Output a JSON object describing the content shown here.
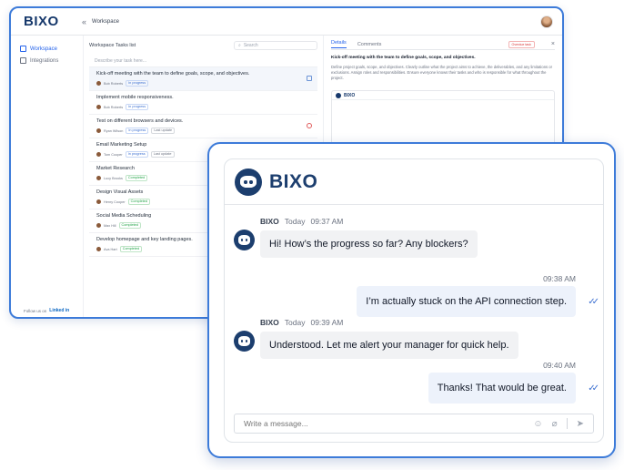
{
  "workspace": {
    "logo": "BIXO",
    "collapse_icon": "«",
    "title": "Workspace",
    "sidebar": {
      "items": [
        {
          "label": "Workspace",
          "active": true
        },
        {
          "label": "Integrations",
          "active": false
        }
      ],
      "follow_us": "Follow us on",
      "linkedin": "Linked in"
    },
    "tasks_header": {
      "name": "Workspace Tasks list",
      "search_placeholder": "Search"
    },
    "describe_placeholder": "Describe your task here...",
    "tasks": [
      {
        "title": "Kick-off meeting with the team to define goals, scope, and objectives.",
        "assignee": "Bob Roberts",
        "tags": [
          "In progress"
        ],
        "icon": "doc"
      },
      {
        "title": "Implement mobile responsiveness.",
        "assignee": "Bob Roberts",
        "tags": [
          "In progress"
        ],
        "icon": ""
      },
      {
        "title": "Test on different browsers and devices.",
        "assignee": "Ryan Wilson",
        "tags": [
          "In progress",
          "Last update"
        ],
        "icon": "alert"
      },
      {
        "title": "Email Marketing Setup",
        "assignee": "Tom Cooper",
        "tags": [
          "In progress",
          "Last update"
        ],
        "icon": ""
      },
      {
        "title": "Market Research",
        "assignee": "Lucy Brooks",
        "tags": [
          "Completed"
        ],
        "icon": ""
      },
      {
        "title": "Design Visual Assets",
        "assignee": "Henry Cooper",
        "tags": [
          "Completed"
        ],
        "icon": ""
      },
      {
        "title": "Social Media Scheduling",
        "assignee": "Max Hill",
        "tags": [
          "Completed"
        ],
        "icon": ""
      },
      {
        "title": "Develop homepage and key landing pages.",
        "assignee": "Ava Hart",
        "tags": [
          "Completed"
        ],
        "icon": ""
      }
    ],
    "details": {
      "tabs": [
        "Details",
        "Comments"
      ],
      "badge": "Overdue task",
      "title": "Kick-off meeting with the team to define goals, scope, and objectives.",
      "text": "Define project goals, scope, and objectives. Clearly outline what the project aims to achieve, the deliverables, and any limitations or exclusions. Assign roles and responsibilities. Ensure everyone knows their tasks and who is responsible for what throughout the project.",
      "card_brand": "BIXO"
    }
  },
  "chat": {
    "brand": "BIXO",
    "messages": [
      {
        "sender": "BIXO",
        "day": "Today",
        "time": "09:37 AM",
        "text": "Hi! How’s the progress so far? Any blockers?"
      },
      {
        "time": "09:38 AM",
        "text": "I’m actually stuck on the API connection step."
      },
      {
        "sender": "BIXO",
        "day": "Today",
        "time": "09:39 AM",
        "text": "Understood. Let me alert your manager for quick help."
      },
      {
        "time": "09:40 AM",
        "text": "Thanks! That would be great."
      }
    ],
    "composer_placeholder": "Write a message...",
    "read_check": "✓✓",
    "icons": [
      "emoji-icon",
      "attach-icon",
      "send-icon"
    ],
    "colors": {
      "brand_navy": "#1c3e6e",
      "accent_blue": "#3d7bd9"
    }
  }
}
